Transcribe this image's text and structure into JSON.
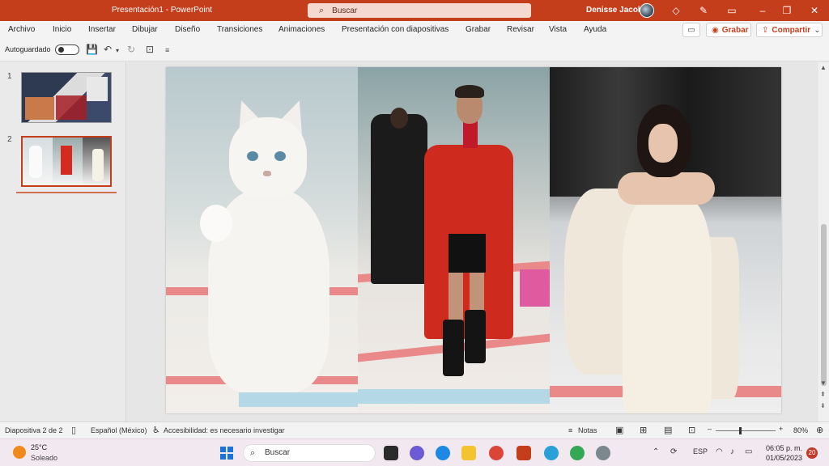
{
  "titlebar": {
    "doc_title": "Presentación1  -  PowerPoint",
    "search_placeholder": "Buscar",
    "user_name": "Denisse Jacobo"
  },
  "ribbon": {
    "tabs": [
      "Archivo",
      "Inicio",
      "Insertar",
      "Dibujar",
      "Diseño",
      "Transiciones",
      "Animaciones",
      "Presentación con diapositivas",
      "Grabar",
      "Revisar",
      "Vista",
      "Ayuda"
    ],
    "record_label": "Grabar",
    "share_label": "Compartir"
  },
  "qat": {
    "autosave_label": "Autoguardado"
  },
  "thumbnails": {
    "items": [
      {
        "number": "1"
      },
      {
        "number": "2"
      }
    ],
    "selected": 2
  },
  "statusbar": {
    "slide_info": "Diapositiva 2 de 2",
    "language": "Español (México)",
    "accessibility": "Accesibilidad: es necesario investigar",
    "notes_label": "Notas",
    "zoom": "80%"
  },
  "taskbar": {
    "temperature": "25°C",
    "condition": "Soleado",
    "search_label": "Buscar",
    "language": "ESP",
    "time": "06:05 p. m.",
    "date": "01/05/2023",
    "notification_count": "20"
  },
  "colors": {
    "accent": "#c43e1c",
    "taskbar": "#f2e8ef"
  }
}
